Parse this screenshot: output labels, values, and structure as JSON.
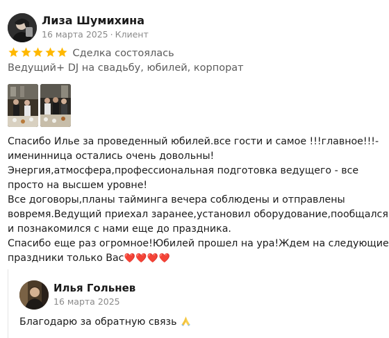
{
  "review": {
    "author_name": "Лиза Шумихина",
    "date": "16 марта 2025",
    "separator": "·",
    "role": "Клиент",
    "rating": 5,
    "rating_max": 5,
    "deal_status": "Сделка состоялась",
    "service": "Ведущий+ DJ на свадьбу, юбилей, корпорат",
    "photos": [
      "photo-1",
      "photo-2"
    ],
    "text_lines": [
      "Спасибо Илье за проведенный юбилей.все гости и самое !!!главное!!!-",
      "именинница остались очень довольны!",
      "Энергия,атмосфера,профессиональная подготовка ведущего - все",
      "просто на высшем уровне!",
      "Все договоры,планы тайминга вечера соблюдены и отправлены",
      "вовремя.Ведущий приехал заранее,установил оборудование,пообщался",
      "и познакомился с нами еще до праздника.",
      "Спасибо еще раз огромное!Юбилей прошел на ура!Ждем на следующие",
      "праздники только Вас"
    ],
    "text_hearts": "❤️❤️❤️❤️"
  },
  "reply": {
    "author_name": "Илья Гольнев",
    "date": "16 марта 2025",
    "text": "Благодарю за обратную связь",
    "emoji": "pray-icon"
  },
  "colors": {
    "star": "#ffb800",
    "heart": "#e0394a",
    "muted_text": "#8a8a8a",
    "secondary_text": "#5b5b5b",
    "reply_bar": "#e4e4e4"
  }
}
